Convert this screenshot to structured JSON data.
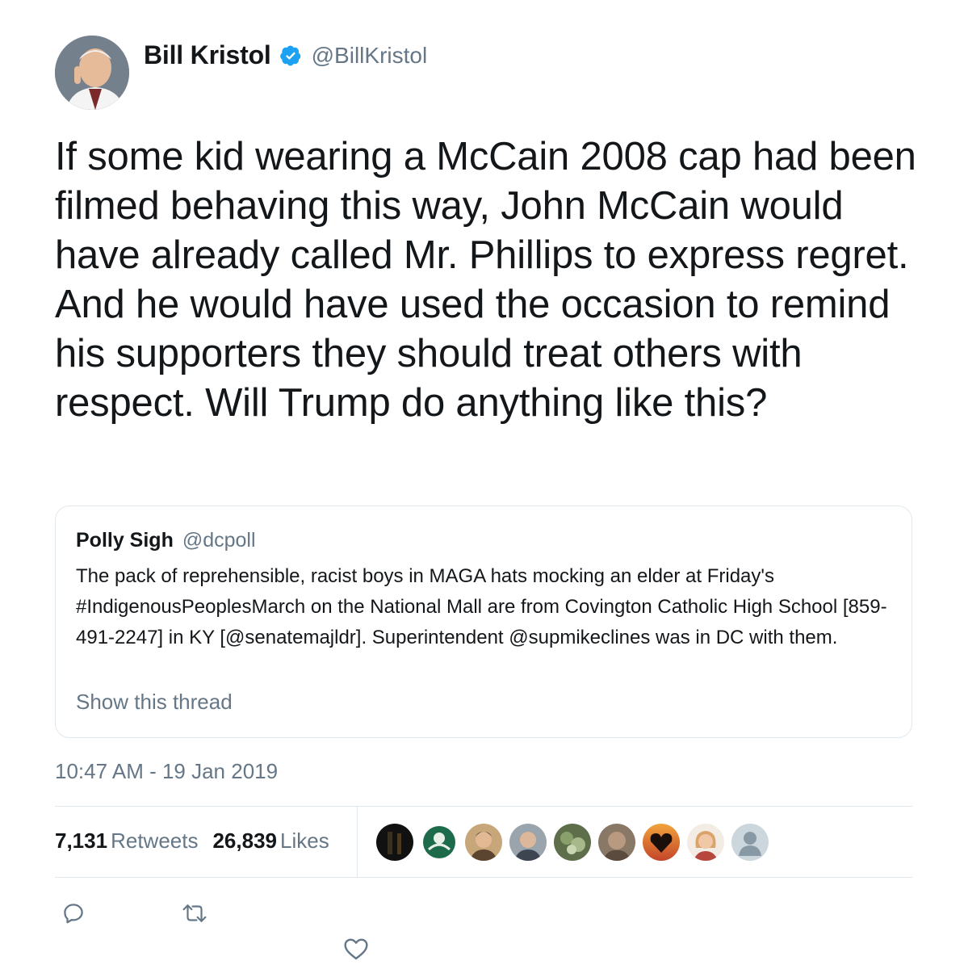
{
  "author": {
    "name": "Bill Kristol",
    "handle": "@BillKristol",
    "verified": true,
    "avatar_icon": "profile-photo"
  },
  "tweet": {
    "text": "If some kid wearing a McCain 2008 cap had been filmed behaving this way, John McCain would have already called Mr. Phillips to express regret. And he would have used the occasion to remind his supporters they should treat others with respect. Will Trump do anything like this?",
    "timestamp": "10:47 AM - 19 Jan 2019"
  },
  "quoted_tweet": {
    "name": "Polly Sigh",
    "handle": "@dcpoll",
    "text": "The pack of reprehensible, racist boys in MAGA hats mocking an elder at Friday's #IndigenousPeoplesMarch on the National Mall are from Covington Catholic High School [859-491-2247] in KY [@senatemajldr]. Superintendent @supmikeclines was in DC with them.",
    "show_thread": "Show this thread"
  },
  "stats": {
    "retweets_count": "7,131",
    "retweets_label": "Retweets",
    "likes_count": "26,839",
    "likes_label": "Likes"
  },
  "likers": [
    {
      "icon": "dark-photo-avatar",
      "color": "#1a1a1a"
    },
    {
      "icon": "green-emblem-avatar",
      "color": "#1d6b4b"
    },
    {
      "icon": "man-photo-avatar",
      "color": "#8a6a4a"
    },
    {
      "icon": "man-photo-avatar",
      "color": "#7e8a96"
    },
    {
      "icon": "plant-photo-avatar",
      "color": "#6c7a55"
    },
    {
      "icon": "face-photo-avatar",
      "color": "#7a6a5a"
    },
    {
      "icon": "heart-hands-avatar",
      "color": "#c0532a"
    },
    {
      "icon": "woman-photo-avatar",
      "color": "#d9a77e"
    },
    {
      "icon": "default-user-avatar",
      "color": "#ccd6dd"
    }
  ],
  "actions": [
    "reply-icon",
    "retweet-icon",
    "like-icon"
  ],
  "colors": {
    "text": "#14171a",
    "secondary": "#657786",
    "border": "#e1e8ed",
    "verified_blue": "#1da1f2"
  }
}
